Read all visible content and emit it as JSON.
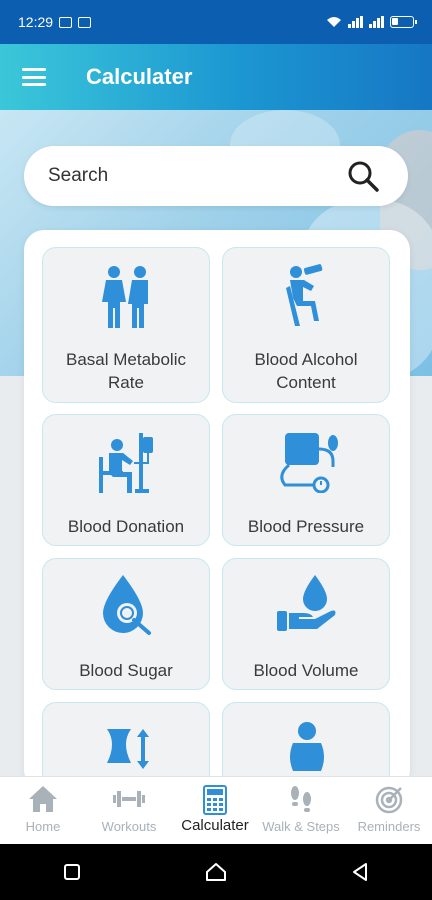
{
  "status": {
    "time": "12:29"
  },
  "app_bar": {
    "title": "Calculater"
  },
  "search": {
    "placeholder": "Search"
  },
  "tiles": [
    {
      "label": "Basal Metabolic Rate",
      "icon": "couple-icon"
    },
    {
      "label": "Blood Alcohol Content",
      "icon": "drinking-person-icon"
    },
    {
      "label": "Blood Donation",
      "icon": "blood-donation-icon"
    },
    {
      "label": "Blood Pressure",
      "icon": "blood-pressure-icon"
    },
    {
      "label": "Blood Sugar",
      "icon": "blood-drop-magnifier-icon"
    },
    {
      "label": "Blood Volume",
      "icon": "hand-drop-icon"
    },
    {
      "label": "",
      "icon": "waist-measure-icon"
    },
    {
      "label": "",
      "icon": "person-icon"
    }
  ],
  "bottom_nav": [
    {
      "label": "Home",
      "icon": "home-icon",
      "active": false
    },
    {
      "label": "Workouts",
      "icon": "dumbbell-icon",
      "active": false
    },
    {
      "label": "Calculater",
      "icon": "calculator-icon",
      "active": true
    },
    {
      "label": "Walk & Steps",
      "icon": "footsteps-icon",
      "active": false
    },
    {
      "label": "Reminders",
      "icon": "target-icon",
      "active": false
    }
  ],
  "colors": {
    "accent": "#2f8fd8",
    "status_bar": "#0b5eb0",
    "inactive": "#a8b2b8"
  }
}
